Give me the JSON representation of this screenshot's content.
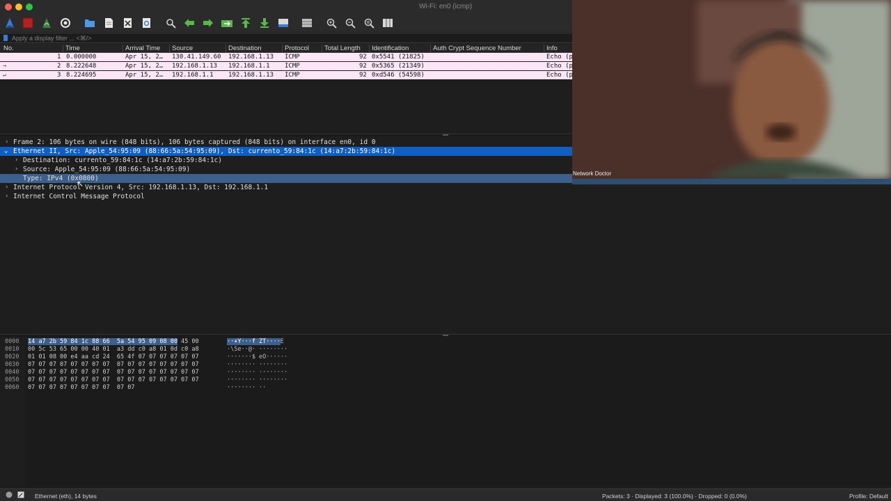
{
  "window": {
    "title": "Wi-Fi: en0 (icmp)"
  },
  "filter": {
    "placeholder": "Apply a display filter ... <⌘/>"
  },
  "packet_list": {
    "columns": [
      "No.",
      "Time",
      "Arrival Time",
      "Source",
      "Destination",
      "Protocol",
      "Total Length",
      "Identification",
      "Auth Crypt Sequence Number",
      "Info"
    ],
    "rows": [
      {
        "no": "1",
        "time": "0.000000",
        "arrival": "Apr 15, 2…",
        "source": "130.41.149.60",
        "destination": "192.168.1.13",
        "protocol": "ICMP",
        "total_length": "92",
        "identification": "0x5541 (21825)",
        "auth": "",
        "info": "Echo (p"
      },
      {
        "no": "2",
        "time": "8.222648",
        "arrival": "Apr 15, 2…",
        "source": "192.168.1.13",
        "destination": "192.168.1.1",
        "protocol": "ICMP",
        "total_length": "92",
        "identification": "0x5365 (21349)",
        "auth": "",
        "info": "Echo (p"
      },
      {
        "no": "3",
        "time": "8.224695",
        "arrival": "Apr 15, 2…",
        "source": "192.168.1.1",
        "destination": "192.168.1.13",
        "protocol": "ICMP",
        "total_length": "92",
        "identification": "0xd546 (54598)",
        "auth": "",
        "info": "Echo (p"
      }
    ]
  },
  "details": {
    "frame": "Frame 2: 106 bytes on wire (848 bits), 106 bytes captured (848 bits) on interface en0, id 0",
    "ethernet": "Ethernet II, Src: Apple_54:95:09 (88:66:5a:54:95:09), Dst: currento_59:84:1c (14:a7:2b:59:84:1c)",
    "destination": "Destination: currento_59:84:1c (14:a7:2b:59:84:1c)",
    "source": "Source: Apple_54:95:09 (88:66:5a:54:95:09)",
    "type": "Type: IPv4 (0x0800)",
    "ipv4": "Internet Protocol Version 4, Src: 192.168.1.13, Dst: 192.168.1.1",
    "icmp": "Internet Control Message Protocol"
  },
  "bytes": {
    "rows": [
      {
        "offset": "0000",
        "hex_hl": "14 a7 2b 59 84 1c 88 66  5a 54 95 09 08 00",
        "hex_rest": " 45 00",
        "ascii_hl": "··+Y···f ZT····",
        "ascii_rest": "E"
      },
      {
        "offset": "0010",
        "hex_hl": "",
        "hex_rest": "00 5c 53 65 00 00 40 01  a3 dd c0 a8 01 0d c0 a8",
        "ascii_hl": "",
        "ascii_rest": "·\\Se··@· ········"
      },
      {
        "offset": "0020",
        "hex_hl": "",
        "hex_rest": "01 01 08 00 e4 aa cd 24  65 4f 07 07 07 07 07 07",
        "ascii_hl": "",
        "ascii_rest": "·······$ eO······"
      },
      {
        "offset": "0030",
        "hex_hl": "",
        "hex_rest": "07 07 07 07 07 07 07 07  07 07 07 07 07 07 07 07",
        "ascii_hl": "",
        "ascii_rest": "········ ········"
      },
      {
        "offset": "0040",
        "hex_hl": "",
        "hex_rest": "07 07 07 07 07 07 07 07  07 07 07 07 07 07 07 07",
        "ascii_hl": "",
        "ascii_rest": "········ ········"
      },
      {
        "offset": "0050",
        "hex_hl": "",
        "hex_rest": "07 07 07 07 07 07 07 07  07 07 07 07 07 07 07 07",
        "ascii_hl": "",
        "ascii_rest": "········ ········"
      },
      {
        "offset": "0060",
        "hex_hl": "",
        "hex_rest": "07 07 07 07 07 07 07 07  07 07",
        "ascii_hl": "",
        "ascii_rest": "········ ··"
      }
    ]
  },
  "status": {
    "field": "Ethernet (eth), 14 bytes",
    "packets": "Packets: 3 · Displayed: 3 (100.0%) · Dropped: 0 (0.0%)",
    "profile": "Profile: Default"
  },
  "webcam": {
    "caption": "Network Doctor"
  }
}
